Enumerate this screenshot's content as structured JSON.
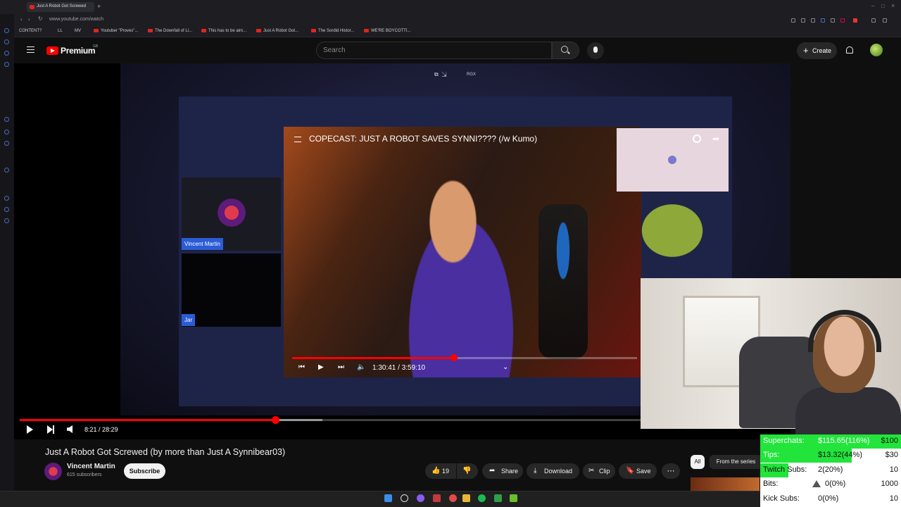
{
  "browser": {
    "tab_title": "Just A Robot Got Screwed",
    "url": "www.youtube.com/watch",
    "bookmarks": [
      "CONTENT?",
      "LL",
      "MV",
      "Youtuber \"Proves\"...",
      "The Downfall of Li...",
      "This has to be aim...",
      "Just A Robot Got...",
      "The Sordid Histor...",
      "WE'RE BOYCOTTI..."
    ]
  },
  "header": {
    "brand": "Premium",
    "brand_sup": "GB",
    "search_placeholder": "Search",
    "create_label": "Create"
  },
  "player": {
    "inner_stream": {
      "title": "COPECAST: JUST A ROBOT SAVES SYNNI???? (/w Kumo)",
      "time": "1:30:41 / 3:59:10",
      "progress_fraction": 0.378,
      "top_label": "RGX",
      "participant_1": "Vincent Martin",
      "participant_2": "Jar"
    },
    "time": "8:21 / 28:29",
    "progress_fraction": 0.293
  },
  "video": {
    "title": "Just A Robot Got Screwed (by more than Just A Synnibear03)",
    "channel_name": "Vincent Martin",
    "subscribers": "615 subscribers",
    "subscribe_label": "Subscribe",
    "like_count": "19",
    "share_label": "Share",
    "download_label": "Download",
    "clip_label": "Clip",
    "save_label": "Save"
  },
  "chips": {
    "all": "All",
    "from_series": "From the series"
  },
  "stats": {
    "rows": [
      {
        "label": "Superchats:",
        "value": "$115.65(116%)",
        "goal": "$100",
        "fraction": 1.0
      },
      {
        "label": "Tips:",
        "value": "$13.32(44%)",
        "goal": "$30",
        "fraction": 0.44
      },
      {
        "label": "Twitch Subs:",
        "value": "2(20%)",
        "goal": "10",
        "fraction": 0.2
      },
      {
        "label": "Bits:",
        "value": "0(0%)",
        "goal": "1000",
        "fraction": 0
      },
      {
        "label": "Kick Subs:",
        "value": "0(0%)",
        "goal": "10",
        "fraction": 0
      }
    ]
  },
  "colors": {
    "accent_red": "#ff0000",
    "progress_green": "#22e43b",
    "name_tag_blue": "#2b5cd6"
  }
}
